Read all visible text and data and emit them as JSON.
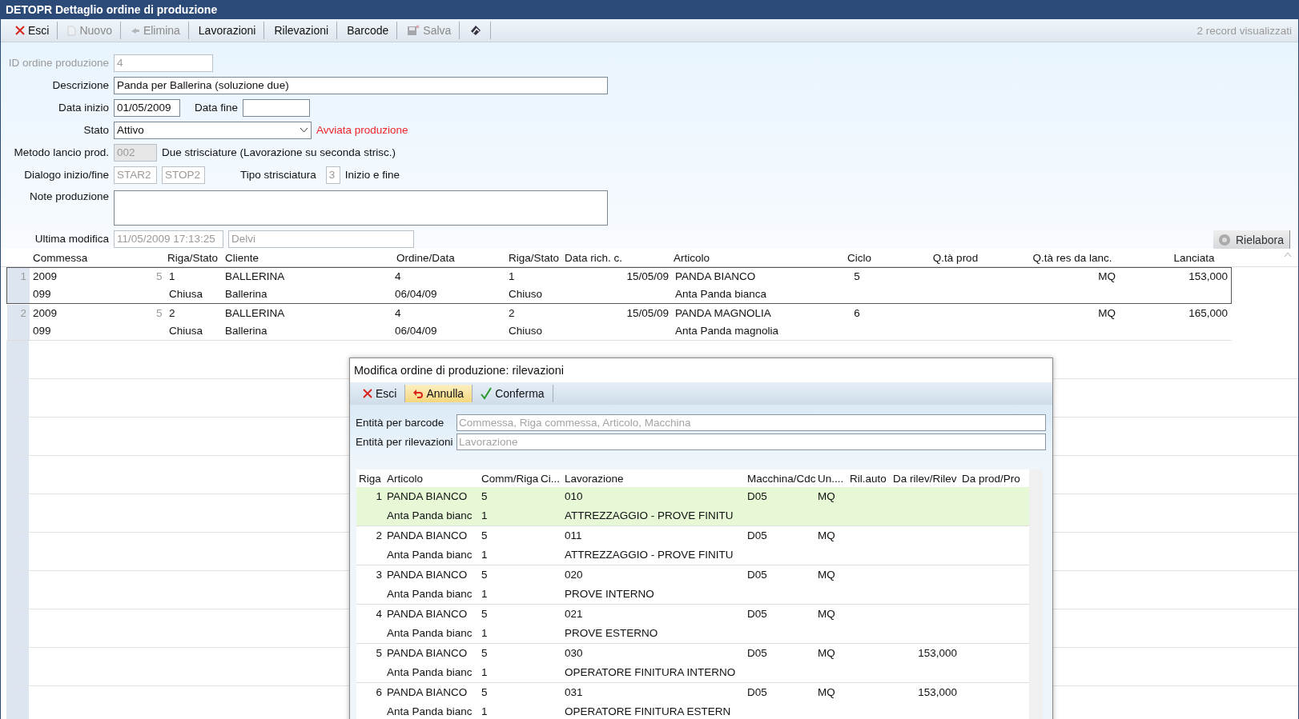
{
  "window": {
    "title": "DETOPR Dettaglio ordine di produzione"
  },
  "toolbar": {
    "buttons": [
      {
        "kind": "close",
        "label": "Esci",
        "disabled": false
      },
      {
        "kind": "new",
        "label": "Nuovo",
        "disabled": true
      },
      {
        "kind": "delete",
        "label": "Elimina",
        "disabled": true
      },
      {
        "kind": "text",
        "label": "Lavorazioni",
        "disabled": false
      },
      {
        "kind": "text",
        "label": "Rilevazioni",
        "disabled": false
      },
      {
        "kind": "text",
        "label": "Barcode",
        "disabled": false
      },
      {
        "kind": "save",
        "label": "Salva",
        "disabled": true
      },
      {
        "kind": "tool",
        "disabled": false
      }
    ],
    "record_count": "2 record visualizzati"
  },
  "form": {
    "id": {
      "label": "ID ordine produzione",
      "value": "4",
      "disabled": true
    },
    "descrizione": {
      "label": "Descrizione",
      "value": "Panda per Ballerina (soluzione due)"
    },
    "data_inizio": {
      "label": "Data inizio",
      "value": "01/05/2009"
    },
    "data_fine": {
      "label": "Data fine"
    },
    "stato": {
      "label": "Stato",
      "value": "Attivo",
      "note": "Avviata produzione"
    },
    "metodo": {
      "label": "Metodo lancio prod.",
      "code": "002",
      "description": "Due strisciature (Lavorazione su seconda strisc.)"
    },
    "dialogo": {
      "label": "Dialogo inizio/fine",
      "start": "STAR2",
      "stop": "STOP2",
      "tipo_label": "Tipo strisciatura",
      "tipo_code": "3",
      "tipo_description": "Inizio e fine"
    },
    "note": {
      "label": "Note produzione"
    },
    "ultima_modifica": {
      "label": "Ultima modifica",
      "timestamp": "11/05/2009 17:13:25",
      "user": "Delvi"
    },
    "rielabora": "Rielabora"
  },
  "table": {
    "columns": [
      "Commessa",
      "Riga/Stato",
      "Cliente",
      "Ordine/Data",
      "Riga/Stato",
      "Data rich. c.",
      "Articolo",
      "Ciclo",
      "Q.tà prod",
      "Q.tà res da lanc.",
      "Lanciata"
    ],
    "rows": [
      {
        "num": "1",
        "selected": true,
        "commessa": "2009",
        "commessa_2": "099",
        "count": "5",
        "riga": "1",
        "stato": "Chiusa",
        "cliente": "BALLERINA",
        "cliente_2": "Ballerina",
        "ordine": "4",
        "data": "06/04/09",
        "riga_ord": "1",
        "stato_ord": "Chiuso",
        "data_rich": "15/05/09",
        "articolo": "PANDA BIANCO",
        "articolo_2": "Anta Panda bianca",
        "ciclo": "5",
        "unit": "MQ",
        "lanciata": "153,000"
      },
      {
        "num": "2",
        "selected": false,
        "commessa": "2009",
        "commessa_2": "099",
        "count": "5",
        "riga": "2",
        "stato": "Chiusa",
        "cliente": "BALLERINA",
        "cliente_2": "Ballerina",
        "ordine": "4",
        "data": "06/04/09",
        "riga_ord": "2",
        "stato_ord": "Chiuso",
        "data_rich": "15/05/09",
        "articolo": "PANDA MAGNOLIA",
        "articolo_2": "Anta Panda magnolia",
        "ciclo": "6",
        "unit": "MQ",
        "lanciata": "165,000"
      }
    ]
  },
  "dialog": {
    "title": "Modifica ordine di produzione: rilevazioni",
    "buttons": [
      {
        "kind": "close",
        "label": "Esci",
        "highlighted": false
      },
      {
        "kind": "undo",
        "label": "Annulla",
        "highlighted": true
      },
      {
        "kind": "confirm",
        "label": "Conferma",
        "highlighted": false
      }
    ],
    "fields": [
      {
        "label": "Entità per barcode",
        "placeholder": "Commessa, Riga commessa, Articolo, Macchina"
      },
      {
        "label": "Entità per rilevazioni",
        "placeholder": "Lavorazione"
      }
    ],
    "columns": [
      "Riga",
      "Articolo",
      "Comm/Riga",
      "Ci...",
      "Lavorazione",
      "Macchina/Cdc",
      "Un....",
      "Ril.auto",
      "Da rilev/Rilev",
      "Da prod/Pro"
    ],
    "rows": [
      {
        "riga": "1",
        "selected": true,
        "articolo": "PANDA BIANCO",
        "articolo_2": "Anta Panda bianc",
        "comm": "5",
        "riga_comm": "1",
        "codice": "010",
        "lavorazione": "ATTREZZAGGIO - PROVE FINITU",
        "macchina": "D05",
        "unit": "MQ"
      },
      {
        "riga": "2",
        "selected": false,
        "articolo": "PANDA BIANCO",
        "articolo_2": "Anta Panda bianc",
        "comm": "5",
        "riga_comm": "1",
        "codice": "011",
        "lavorazione": "ATTREZZAGGIO - PROVE FINITU",
        "macchina": "D05",
        "unit": "MQ"
      },
      {
        "riga": "3",
        "selected": false,
        "articolo": "PANDA BIANCO",
        "articolo_2": "Anta Panda bianc",
        "comm": "5",
        "riga_comm": "1",
        "codice": "020",
        "lavorazione": "PROVE INTERNO",
        "macchina": "D05",
        "unit": "MQ"
      },
      {
        "riga": "4",
        "selected": false,
        "articolo": "PANDA BIANCO",
        "articolo_2": "Anta Panda bianc",
        "comm": "5",
        "riga_comm": "1",
        "codice": "021",
        "lavorazione": "PROVE ESTERNO",
        "macchina": "D05",
        "unit": "MQ"
      },
      {
        "riga": "5",
        "selected": false,
        "articolo": "PANDA BIANCO",
        "articolo_2": "Anta Panda bianc",
        "comm": "5",
        "riga_comm": "1",
        "codice": "030",
        "lavorazione": "OPERATORE FINITURA INTERNO",
        "macchina": "D05",
        "unit": "MQ",
        "da_rilev": "153,000"
      },
      {
        "riga": "6",
        "selected": false,
        "articolo": "PANDA BIANCO",
        "articolo_2": "Anta Panda bianc",
        "comm": "5",
        "riga_comm": "1",
        "codice": "031",
        "lavorazione": "OPERATORE FINITURA ESTERN",
        "macchina": "D05",
        "unit": "MQ",
        "da_rilev": "153,000"
      }
    ]
  }
}
